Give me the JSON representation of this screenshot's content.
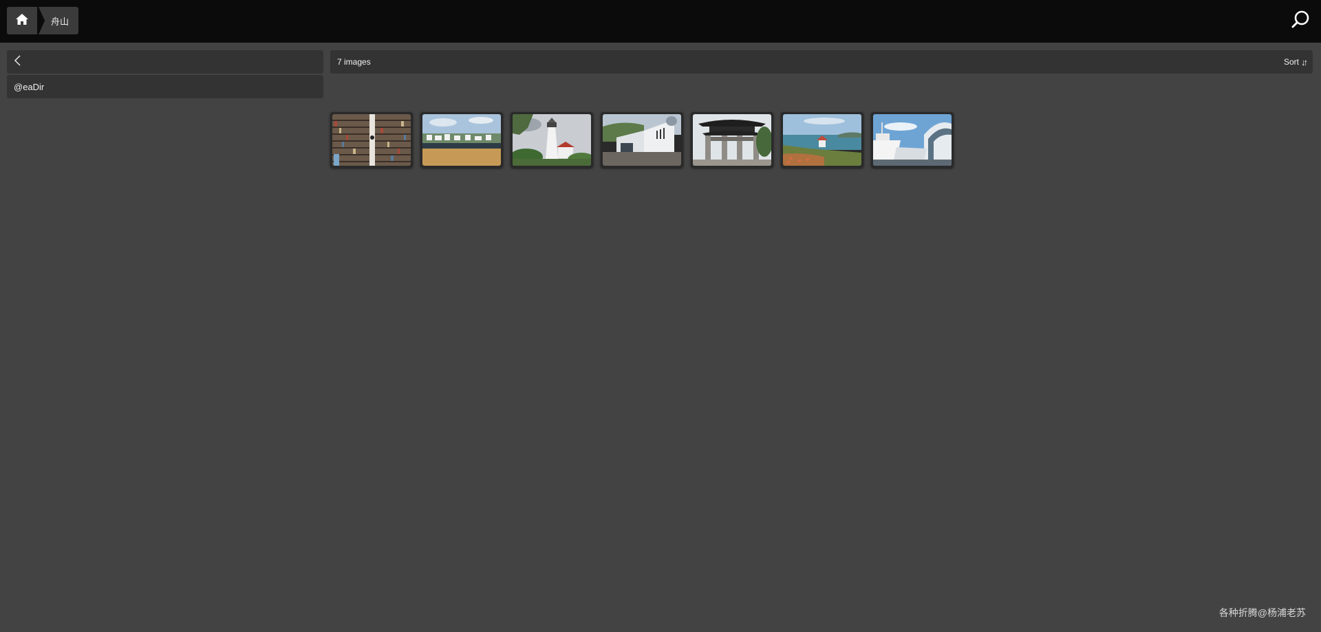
{
  "breadcrumb": {
    "home_icon": "home-icon",
    "current": "舟山"
  },
  "topbar": {
    "search_icon": "search-icon"
  },
  "sidebar": {
    "back_icon": "chevron-left-icon",
    "folders": [
      {
        "label": "@eaDir"
      }
    ]
  },
  "main": {
    "count_label": "7 images",
    "sort_label": "Sort",
    "sort_icon": "sort-arrows-icon",
    "thumbnails": [
      {
        "name": "thumb-bookshelf",
        "scene": "bookshelf"
      },
      {
        "name": "thumb-beach-village",
        "scene": "beach"
      },
      {
        "name": "thumb-lighthouse",
        "scene": "lighthouse"
      },
      {
        "name": "thumb-museum-building",
        "scene": "museum"
      },
      {
        "name": "thumb-memorial-gate",
        "scene": "gate"
      },
      {
        "name": "thumb-seaside-pavilion",
        "scene": "pavilion"
      },
      {
        "name": "thumb-harbor-ships",
        "scene": "ships"
      }
    ]
  },
  "footer": {
    "watermark": "各种折腾@杨浦老苏"
  },
  "colors": {
    "background": "#434343",
    "topbar": "#0b0b0b",
    "panel": "#333333"
  }
}
